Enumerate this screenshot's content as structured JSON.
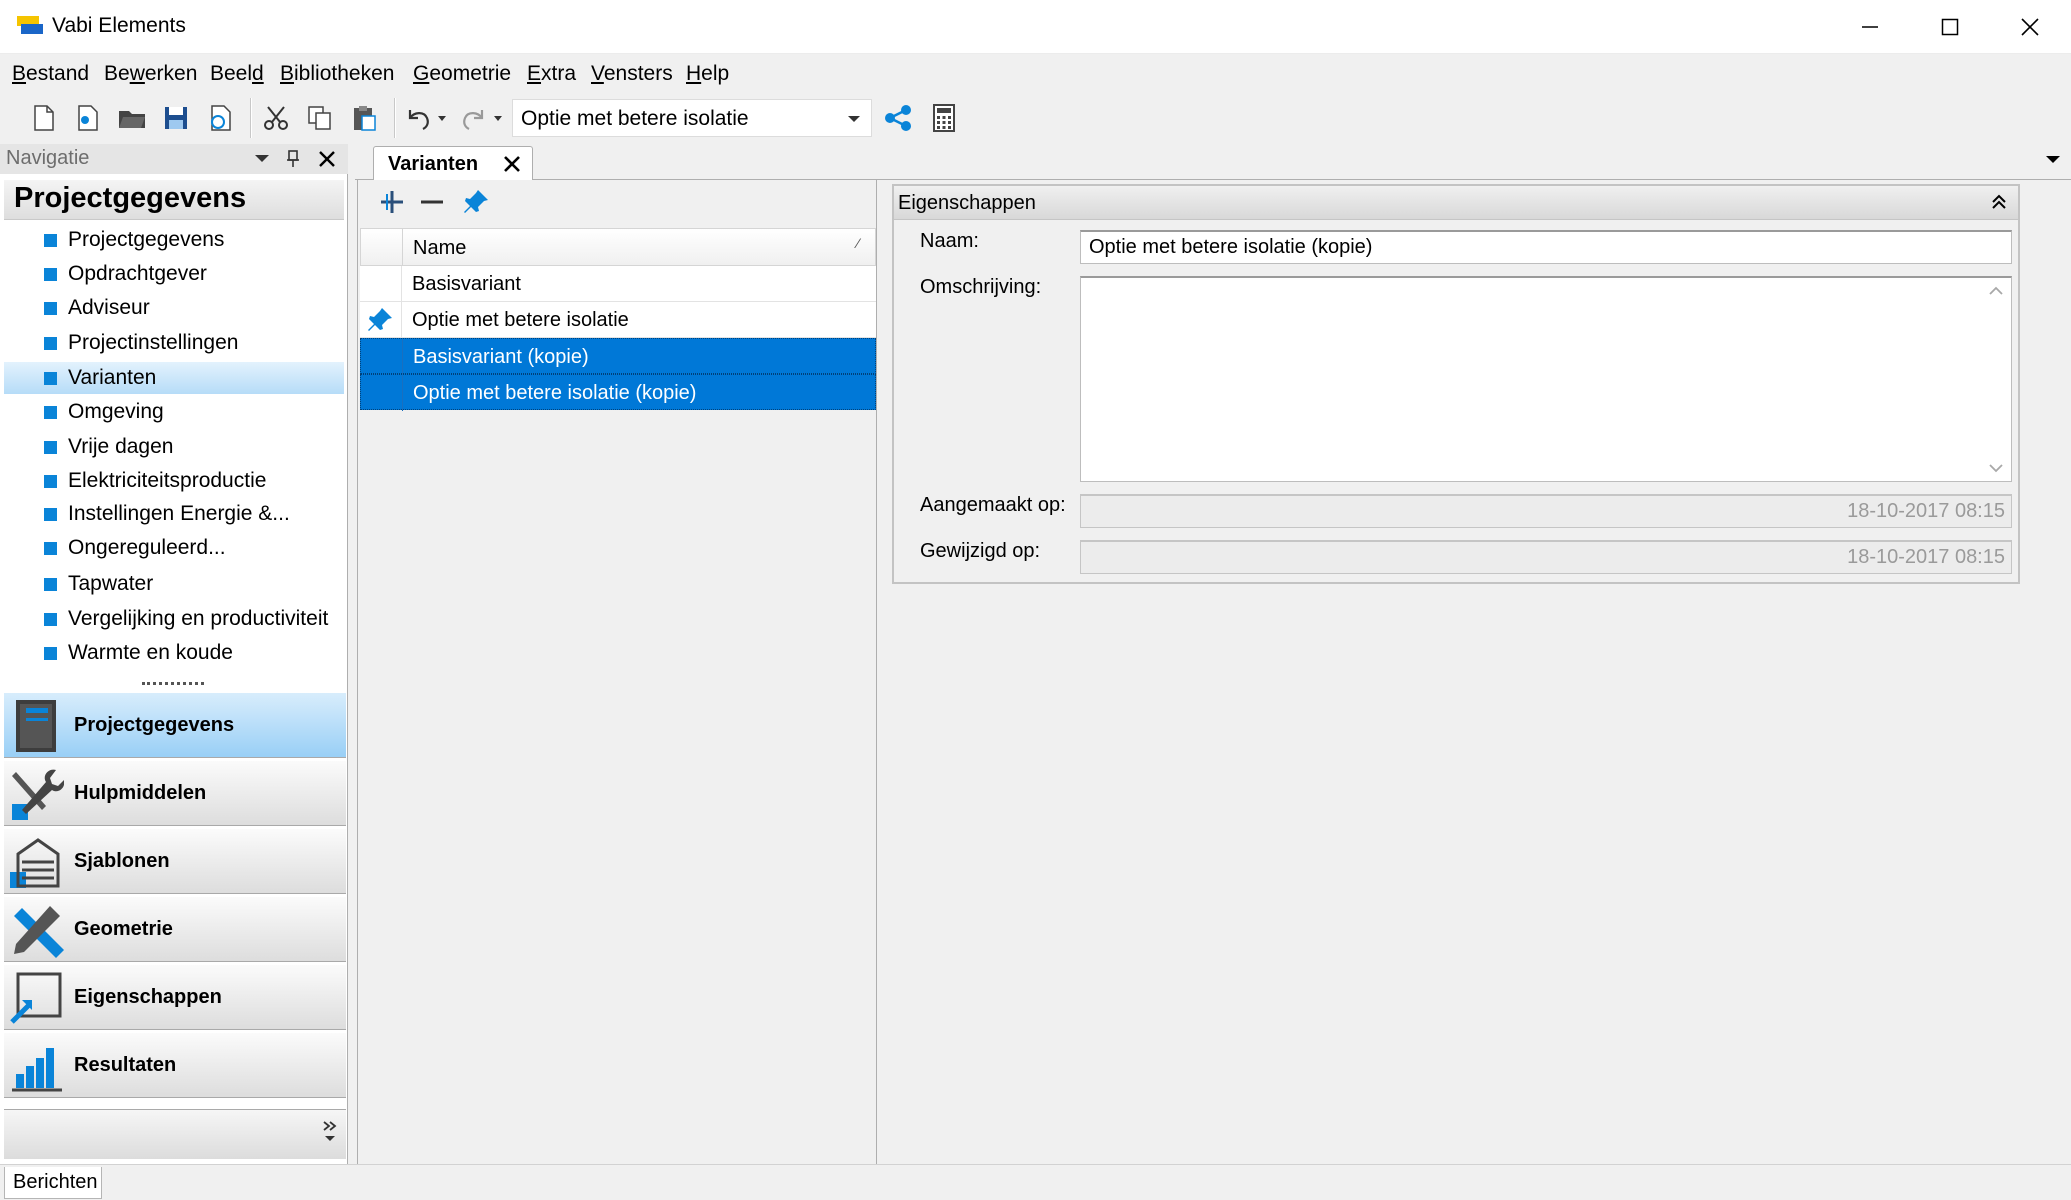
{
  "window": {
    "title": "Vabi Elements",
    "icon": "vabi-app-icon"
  },
  "menu": [
    {
      "pre": "",
      "u": "B",
      "post": "estand"
    },
    {
      "pre": "Be",
      "u": "w",
      "post": "erken"
    },
    {
      "pre": "Beel",
      "u": "d",
      "post": ""
    },
    {
      "pre": "",
      "u": "B",
      "post": "ibliotheken"
    },
    {
      "pre": "",
      "u": "G",
      "post": "eometrie"
    },
    {
      "pre": "",
      "u": "E",
      "post": "xtra"
    },
    {
      "pre": "",
      "u": "V",
      "post": "ensters"
    },
    {
      "pre": "",
      "u": "H",
      "post": "elp"
    }
  ],
  "toolbar": {
    "buttons": [
      "new-icon",
      "new-from-template-icon",
      "open-icon",
      "save-icon",
      "save-as-icon",
      "cut-icon",
      "copy-icon",
      "paste-icon",
      "undo-icon",
      "redo-icon",
      "share-icon",
      "calculator-icon"
    ],
    "variant_selected": "Optie met betere isolatie"
  },
  "navigation": {
    "header": "Navigatie",
    "section_title": "Projectgegevens",
    "items": [
      {
        "label": "Projectgegevens",
        "selected": false
      },
      {
        "label": "Opdrachtgever",
        "selected": false
      },
      {
        "label": "Adviseur",
        "selected": false
      },
      {
        "label": "Projectinstellingen",
        "selected": false
      },
      {
        "label": "Varianten",
        "selected": true
      },
      {
        "label": "Omgeving",
        "selected": false
      },
      {
        "label": "Vrije dagen",
        "selected": false
      },
      {
        "label": "Elektriciteitsproductie",
        "selected": false
      },
      {
        "label": "Instellingen Energie &...",
        "selected": false
      },
      {
        "label": "Ongereguleerd...",
        "selected": false
      },
      {
        "label": "Tapwater",
        "selected": false
      },
      {
        "label": "Vergelijking en productiviteit",
        "selected": false
      },
      {
        "label": "Warmte en koude",
        "selected": false
      }
    ],
    "categories": [
      {
        "label": "Projectgegevens",
        "icon": "book-icon",
        "active": true
      },
      {
        "label": "Hulpmiddelen",
        "icon": "tools-icon",
        "active": false
      },
      {
        "label": "Sjablonen",
        "icon": "template-icon",
        "active": false
      },
      {
        "label": "Geometrie",
        "icon": "geometry-icon",
        "active": false
      },
      {
        "label": "Eigenschappen",
        "icon": "properties-icon",
        "active": false
      },
      {
        "label": "Resultaten",
        "icon": "results-chart-icon",
        "active": false
      }
    ]
  },
  "document_tab": {
    "label": "Varianten"
  },
  "variants": {
    "column_header": "Name",
    "rows": [
      {
        "name": "Basisvariant",
        "pinned": false,
        "selected": false
      },
      {
        "name": "Optie met betere isolatie",
        "pinned": true,
        "selected": false
      },
      {
        "name": "Basisvariant (kopie)",
        "pinned": false,
        "selected": true
      },
      {
        "name": "Optie met betere isolatie (kopie)",
        "pinned": false,
        "selected": true
      }
    ]
  },
  "properties": {
    "title": "Eigenschappen",
    "naam_label": "Naam:",
    "naam_value": "Optie met betere isolatie (kopie)",
    "omschrijving_label": "Omschrijving:",
    "omschrijving_value": "",
    "aangemaakt_label": "Aangemaakt op:",
    "aangemaakt_value": "18-10-2017 08:15",
    "gewijzigd_label": "Gewijzigd op:",
    "gewijzigd_value": "18-10-2017 08:15"
  },
  "statusbar": {
    "tab": "Berichten"
  },
  "colors": {
    "accent": "#0078d7",
    "nav_square": "#0a84d8"
  }
}
